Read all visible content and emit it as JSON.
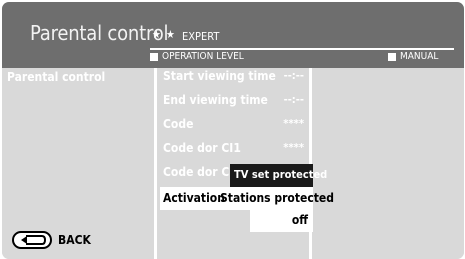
{
  "header": {
    "title": "Parental control",
    "stars": "★ ★",
    "level": "EXPERT",
    "operation_level": "OPERATION LEVEL",
    "manual": "MANUAL"
  },
  "left_panel": {
    "heading": "Parental control",
    "back_label": "BACK",
    "back_icon": "back-arrow-icon"
  },
  "menu": {
    "start_viewing_time": {
      "label": "Start viewing time",
      "value": "--:--"
    },
    "end_viewing_time": {
      "label": "End viewing time",
      "value": "--:--"
    },
    "code": {
      "label": "Code",
      "value": "****"
    },
    "code_dor_ci1": {
      "label": "Code dor CI1",
      "value": "****"
    },
    "code_dor_ci2": {
      "label": "Code dor CI"
    },
    "activation": {
      "label": "Activation"
    }
  },
  "popup": {
    "options": [
      "TV set protected",
      "Stations protected",
      "off"
    ],
    "highlighted": "TV set protected"
  },
  "colors": {
    "header_bg": "#6e6e6e",
    "panel_bg": "#d9d9d9",
    "highlight_bg": "#1a1a1a"
  }
}
